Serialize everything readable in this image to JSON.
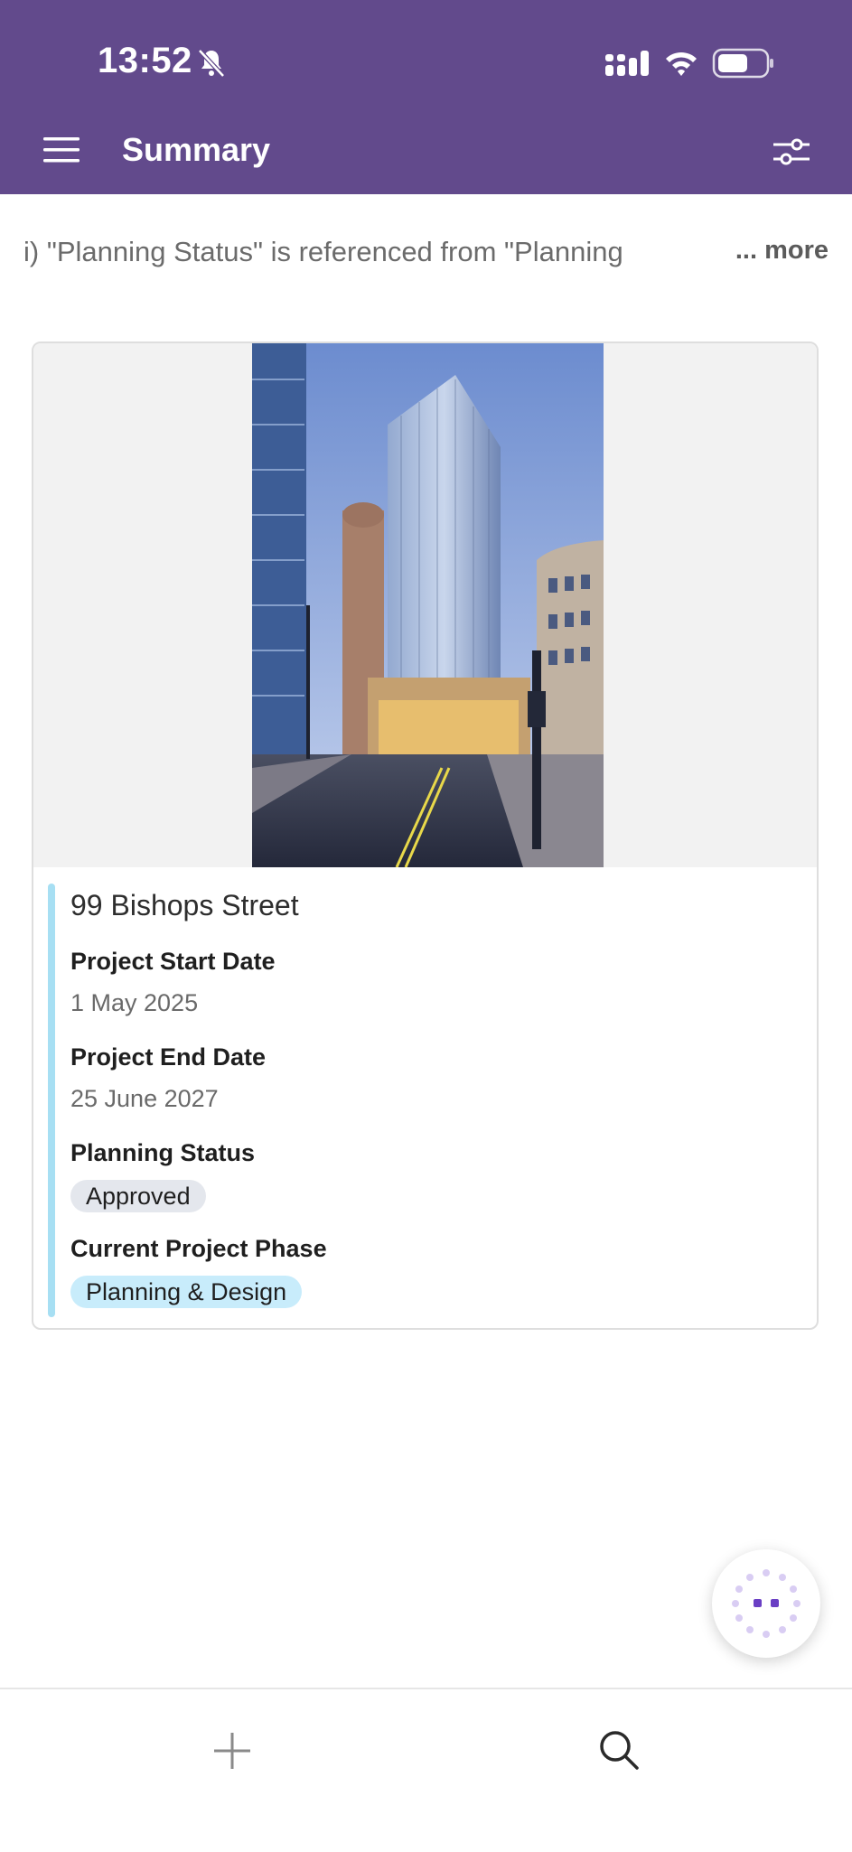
{
  "status_bar": {
    "time": "13:52",
    "icons": [
      "bell-off-icon",
      "cellular-signal-icon",
      "wifi-icon",
      "battery-icon"
    ]
  },
  "header": {
    "title": "Summary",
    "left_icon": "menu-icon",
    "right_icon": "filter-sliders-icon",
    "background_color": "#624a8c"
  },
  "banner": {
    "text": "i) \"Planning Status\" is referenced from \"Planning",
    "more_label": "... more"
  },
  "record": {
    "name": "99 Bishops Street",
    "image": "city-tower-photo",
    "fields": [
      {
        "label": "Project Start Date",
        "value": "1 May 2025"
      },
      {
        "label": "Project End Date",
        "value": "25 June 2027"
      },
      {
        "label": "Planning Status",
        "value": "Approved"
      },
      {
        "label": "Current Project Phase",
        "value": "Planning & Design"
      }
    ]
  },
  "fab": {
    "icon": "loading-dots-icon"
  },
  "bottom_nav": {
    "items": [
      "add-icon",
      "search-icon"
    ]
  },
  "colors": {
    "accent_bar": "#a7dff3",
    "chip_grey": "#e4e7ed",
    "chip_blue": "#c8ecfb",
    "fab_dots": "#6a3fc4"
  }
}
